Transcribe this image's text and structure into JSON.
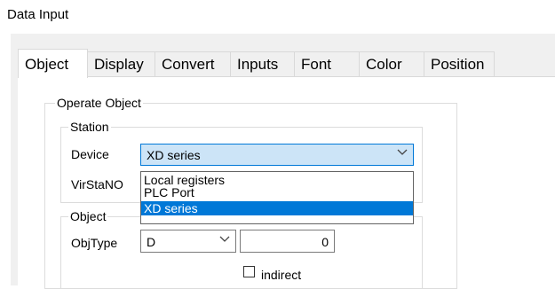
{
  "window": {
    "title": "Data Input"
  },
  "tabs": [
    {
      "label": "Object",
      "active": true
    },
    {
      "label": "Display"
    },
    {
      "label": "Convert"
    },
    {
      "label": "Inputs"
    },
    {
      "label": "Font"
    },
    {
      "label": "Color"
    },
    {
      "label": "Position"
    }
  ],
  "operate_object": {
    "title": "Operate Object",
    "station": {
      "title": "Station",
      "device_label": "Device",
      "device_value": "XD series",
      "virstano_label": "VirStaNO",
      "device_options": [
        "Local registers",
        "PLC Port",
        "XD series"
      ],
      "selected_option": "XD series"
    },
    "object": {
      "title": "Object",
      "objtype_label": "ObjType",
      "objtype_value": "D",
      "address_value": "0",
      "indirect_label": "indirect",
      "indirect_checked": false
    }
  },
  "icons": {
    "dropdown": "chevron-down-icon"
  }
}
